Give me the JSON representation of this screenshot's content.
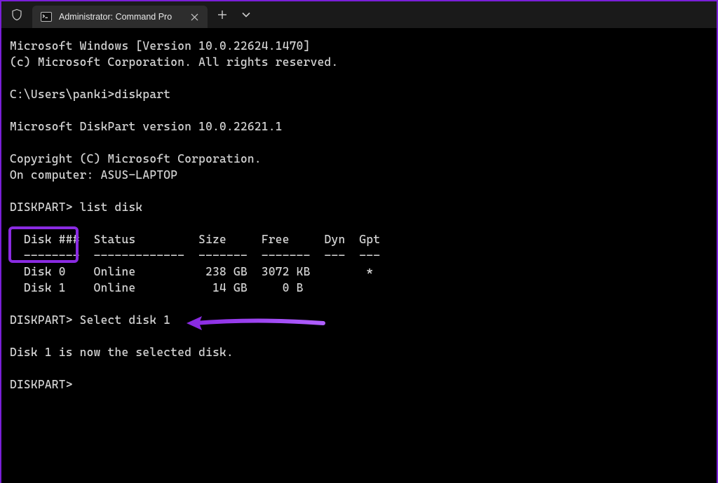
{
  "titlebar": {
    "tab_title": "Administrator: Command Pro"
  },
  "terminal": {
    "line_os1": "Microsoft Windows [Version 10.0.22624.1470]",
    "line_os2": "(c) Microsoft Corporation. All rights reserved.",
    "blank1": "",
    "prompt1": "C:\\Users\\panki>diskpart",
    "blank2": "",
    "dp_ver": "Microsoft DiskPart version 10.0.22621.1",
    "blank3": "",
    "dp_copy": "Copyright (C) Microsoft Corporation.",
    "dp_comp": "On computer: ASUS-LAPTOP",
    "blank4": "",
    "dp_prompt1": "DISKPART> list disk",
    "blank5": "",
    "tbl_hdr": "  Disk ###  Status         Size     Free     Dyn  Gpt",
    "tbl_sep": "  --------  -------------  -------  -------  ---  ---",
    "tbl_row0": "  Disk 0    Online          238 GB  3072 KB        *",
    "tbl_row1": "  Disk 1    Online           14 GB     0 B",
    "blank6": "",
    "dp_prompt2": "DISKPART> Select disk 1",
    "blank7": "",
    "dp_result": "Disk 1 is now the selected disk.",
    "blank8": "",
    "dp_prompt3": "DISKPART>"
  },
  "disk_table": {
    "columns": [
      "Disk ###",
      "Status",
      "Size",
      "Free",
      "Dyn",
      "Gpt"
    ],
    "rows": [
      {
        "disk": "Disk 0",
        "status": "Online",
        "size": "238 GB",
        "free": "3072 KB",
        "dyn": "",
        "gpt": "*"
      },
      {
        "disk": "Disk 1",
        "status": "Online",
        "size": "14 GB",
        "free": "0 B",
        "dyn": "",
        "gpt": ""
      }
    ]
  }
}
